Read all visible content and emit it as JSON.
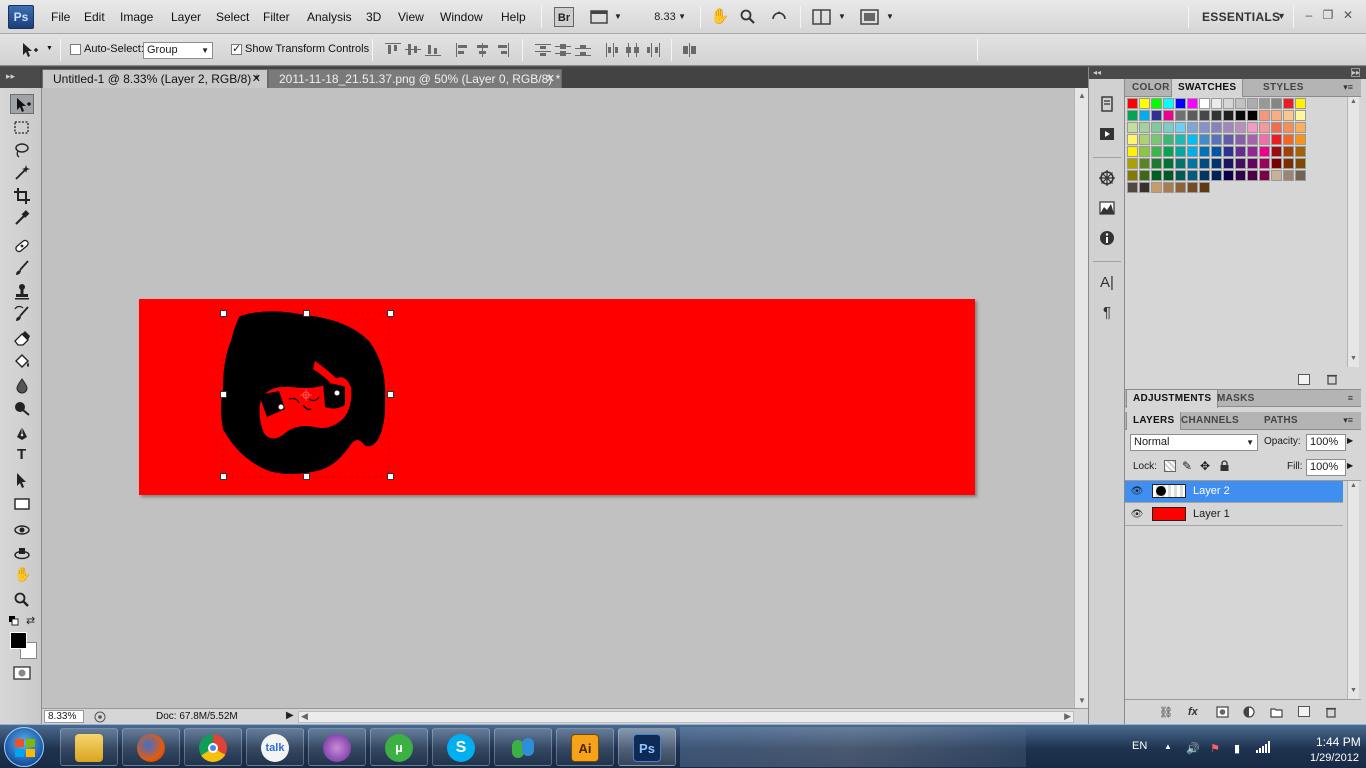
{
  "app": {
    "logo": "Ps",
    "menu": [
      "File",
      "Edit",
      "Image",
      "Layer",
      "Select",
      "Filter",
      "Analysis",
      "3D",
      "View",
      "Window",
      "Help"
    ],
    "bridge_label": "Br",
    "zoom_menu_value": "8.33",
    "workspace": "ESSENTIALS"
  },
  "options": {
    "auto_select_label": "Auto-Select:",
    "auto_select_checked": false,
    "auto_select_mode": "Group",
    "transform_controls_label": "Show Transform Controls",
    "transform_controls_checked": true
  },
  "tabs": [
    {
      "label": "Untitled-1 @ 8.33% (Layer 2, RGB/8) *",
      "active": true
    },
    {
      "label": "2011-11-18_21.51.37.png @ 50% (Layer 0, RGB/8) *",
      "active": false
    }
  ],
  "tools": [
    "move",
    "marquee",
    "lasso",
    "quick-select",
    "crop",
    "eyedropper",
    "healing",
    "brush",
    "stamp",
    "history-brush",
    "eraser",
    "paint-bucket",
    "blur",
    "dodge",
    "pen",
    "type",
    "path-select",
    "shape",
    "3d-rotate",
    "3d-orbit",
    "hand",
    "zoom"
  ],
  "tool_type_glyph": "T",
  "colors": {
    "foreground": "#000000",
    "background": "#ffffff",
    "canvas": "#ff0000",
    "layer_selected": "#3f8ef0"
  },
  "status": {
    "zoom": "8.33%",
    "doc": "Doc: 67.8M/5.52M"
  },
  "panels": {
    "color_tabs": [
      "COLOR",
      "SWATCHES",
      "STYLES"
    ],
    "color_active": "SWATCHES",
    "adjust_tabs": [
      "ADJUSTMENTS",
      "MASKS"
    ],
    "layers_tabs": [
      "LAYERS",
      "CHANNELS",
      "PATHS"
    ],
    "blend_mode": "Normal",
    "opacity_label": "Opacity:",
    "opacity": "100%",
    "lock_label": "Lock:",
    "fill_label": "Fill:",
    "fill": "100%",
    "layers": [
      {
        "name": "Layer 2",
        "selected": true,
        "thumb": "face"
      },
      {
        "name": "Layer 1",
        "selected": false,
        "thumb": "red"
      }
    ],
    "swatches": [
      [
        "#ff0000",
        "#ffff00",
        "#00ff00",
        "#00ffff",
        "#0000ff",
        "#ff00ff",
        "#ffffff",
        "#ebebeb",
        "#d6d6d6",
        "#c2c2c2",
        "#adadad",
        "#999999",
        "#858585",
        "#ed1c24",
        "#fff200"
      ],
      [
        "#00a651",
        "#00aeef",
        "#2e3192",
        "#ec008c",
        "#707070",
        "#5c5c5c",
        "#474747",
        "#333333",
        "#1f1f1f",
        "#0a0a0a",
        "#000000",
        "#f7977a",
        "#f9ad81",
        "#fdc68a",
        "#fff79a"
      ],
      [
        "#c4df9b",
        "#a2d39c",
        "#82ca9d",
        "#7bcdc8",
        "#6ecff6",
        "#7ea7d8",
        "#8493ca",
        "#8882be",
        "#a187be",
        "#bc8dbf",
        "#f49ac2",
        "#f6989d",
        "#f26c4f",
        "#f68e55",
        "#fbaf5c"
      ],
      [
        "#fff467",
        "#acd372",
        "#7cc576",
        "#3bb878",
        "#1abbb4",
        "#00bff3",
        "#438ccb",
        "#5574b9",
        "#605ca8",
        "#855fa8",
        "#a763a8",
        "#f06ea9",
        "#ed1c24",
        "#f26522",
        "#f7941d"
      ],
      [
        "#fff200",
        "#8dc73f",
        "#39b54a",
        "#00a651",
        "#00a99d",
        "#00aeef",
        "#0072bc",
        "#0054a6",
        "#2e3192",
        "#662d91",
        "#92278f",
        "#ec008c",
        "#9e0b0f",
        "#a0410d",
        "#a36209"
      ],
      [
        "#aba000",
        "#598527",
        "#1a7b30",
        "#007236",
        "#00746b",
        "#0076a3",
        "#004b80",
        "#003471",
        "#1b1464",
        "#440e62",
        "#630460",
        "#9e005d",
        "#790000",
        "#7b2e00",
        "#7d4900"
      ],
      [
        "#827b00",
        "#406618",
        "#005e20",
        "#005826",
        "#005952",
        "#005b7f",
        "#003663",
        "#002157",
        "#0d004c",
        "#32004b",
        "#4b0049",
        "#7b0046",
        "#c7b299",
        "#998675",
        "#736357"
      ],
      [
        "#534741",
        "#37302d",
        "#c69c6d",
        "#a67c52",
        "#8c6239",
        "#754c24",
        "#603913"
      ]
    ]
  },
  "taskbar": {
    "apps": [
      "explorer",
      "firefox",
      "chrome",
      "google-talk",
      "itunes",
      "utorrent",
      "skype",
      "messenger",
      "illustrator",
      "photoshop"
    ],
    "talk_label": "talk",
    "illustrator_label": "Ai",
    "photoshop_label": "Ps",
    "language": "EN",
    "time": "1:44 PM",
    "date": "1/29/2012"
  }
}
